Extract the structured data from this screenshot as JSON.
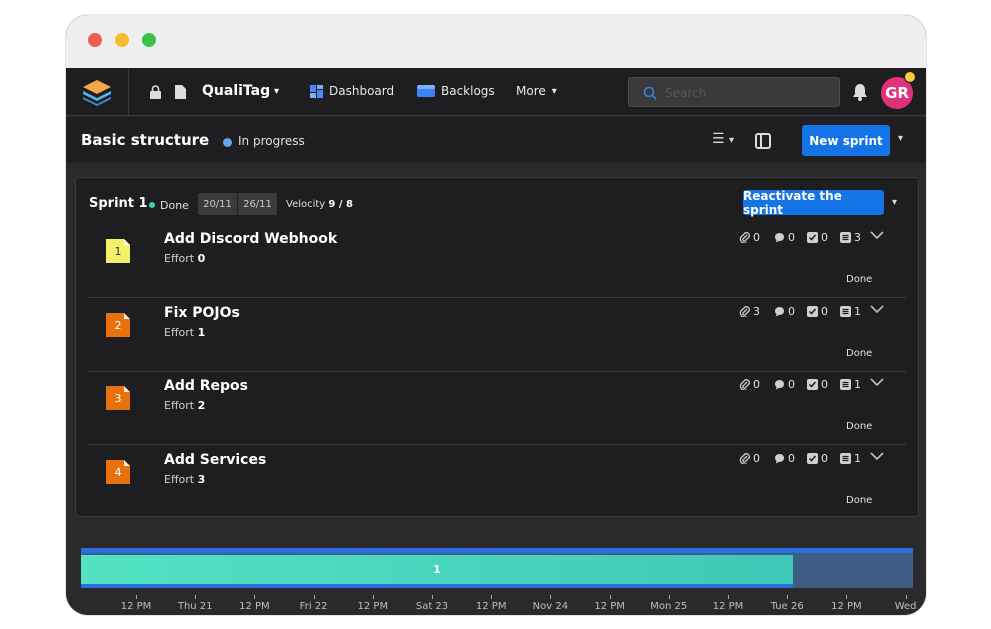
{
  "window_controls": [
    "close",
    "minimize",
    "maximize"
  ],
  "topnav": {
    "project_name": "QualiTag",
    "links": [
      {
        "label": "Dashboard",
        "icon": "dashboard-icon"
      },
      {
        "label": "Backlogs",
        "icon": "backlogs-icon"
      },
      {
        "label": "More",
        "icon": "chevron-down-icon"
      }
    ],
    "search_placeholder": "Search",
    "avatar_initials": "GR"
  },
  "subheader": {
    "title": "Basic structure",
    "status": "In progress",
    "new_sprint_label": "New sprint"
  },
  "sprint": {
    "name": "Sprint 1",
    "status": "Done",
    "start_date": "20/11",
    "end_date": "26/11",
    "velocity_label": "Velocity",
    "velocity_value": "9 / 8",
    "reactivate_label": "Reactivate the sprint",
    "tasks": [
      {
        "number": "1",
        "title": "Add Discord Webhook",
        "effort_label": "Effort",
        "effort": "0",
        "attachments": "0",
        "comments": "0",
        "checklist": "0",
        "subtasks": "3",
        "status": "Done",
        "note_color": "#f5f06a",
        "number_color": "#333333"
      },
      {
        "number": "2",
        "title": "Fix POJOs",
        "effort_label": "Effort",
        "effort": "1",
        "attachments": "3",
        "comments": "0",
        "checklist": "0",
        "subtasks": "1",
        "status": "Done",
        "note_color": "#e8710f",
        "number_color": "#ffffff"
      },
      {
        "number": "3",
        "title": "Add Repos",
        "effort_label": "Effort",
        "effort": "2",
        "attachments": "0",
        "comments": "0",
        "checklist": "0",
        "subtasks": "1",
        "status": "Done",
        "note_color": "#e8710f",
        "number_color": "#ffffff"
      },
      {
        "number": "4",
        "title": "Add Services",
        "effort_label": "Effort",
        "effort": "3",
        "attachments": "0",
        "comments": "0",
        "checklist": "0",
        "subtasks": "1",
        "status": "Done",
        "note_color": "#e8710f",
        "number_color": "#ffffff"
      }
    ]
  },
  "timeline": {
    "bar_label": "1",
    "progress": 0.856,
    "axis_labels": [
      "12 PM",
      "Thu 21",
      "12 PM",
      "Fri 22",
      "12 PM",
      "Sat 23",
      "12 PM",
      "Nov 24",
      "12 PM",
      "Mon 25",
      "12 PM",
      "Tue 26",
      "12 PM",
      "Wed"
    ]
  },
  "colors": {
    "accent": "#1473e6",
    "done": "#36d1b3",
    "in_progress": "#62a6f0",
    "avatar": "#e0317a"
  }
}
